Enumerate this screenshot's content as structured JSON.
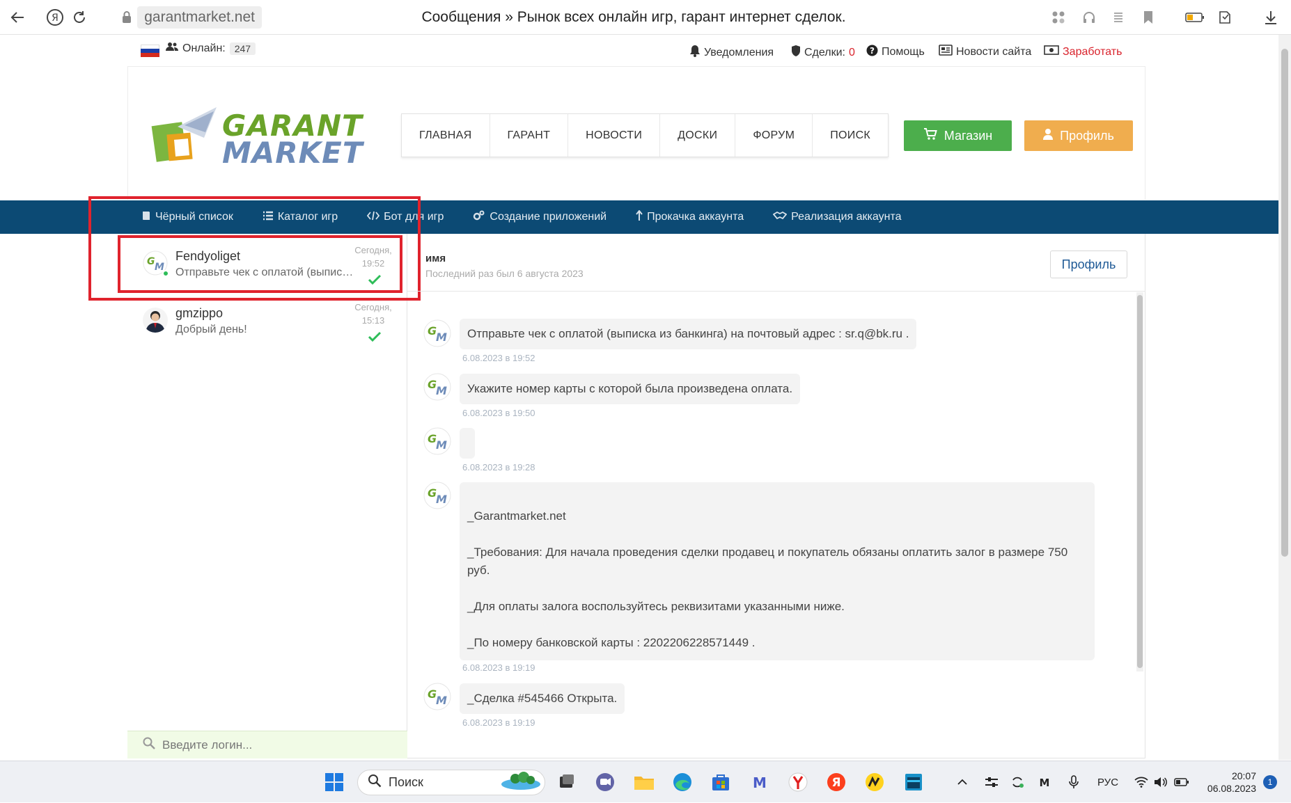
{
  "browser": {
    "domain": "garantmarket.net",
    "tab_title": "Сообщения » Рынок всех онлайн игр, гарант интернет сделок."
  },
  "topbar": {
    "online_label": "Онлайн:",
    "online_count": "247",
    "notifications": "Уведомления",
    "deals_label": "Сделки:",
    "deals_count": "0",
    "help": "Помощь",
    "site_news": "Новости сайта",
    "earn": "Заработать"
  },
  "logo": {
    "line1": "GARANT",
    "line2": "MARKET"
  },
  "mainnav": [
    "ГЛАВНАЯ",
    "ГАРАНТ",
    "НОВОСТИ",
    "ДОСКИ",
    "ФОРУМ",
    "ПОИСК"
  ],
  "buttons": {
    "shop": "Магазин",
    "profile": "Профиль"
  },
  "subnav": [
    "Чёрный список",
    "Каталог игр",
    "Бот для игр",
    "Создание приложений",
    "Прокачка аккаунта",
    "Реализация аккаунта"
  ],
  "dialogs": [
    {
      "name": "Fendyoliget",
      "preview": "Отправьте чек с оплатой (выписка из банкинга) на почтовый адрес : sr.q@bk.ru .",
      "day": "Сегодня,",
      "time": "19:52"
    },
    {
      "name": "gmzippo",
      "preview": "Добрый день!",
      "day": "Сегодня,",
      "time": "15:13"
    }
  ],
  "search_login": {
    "placeholder": "Введите логин..."
  },
  "chat": {
    "name": "имя",
    "last_seen": "Последний раз был 6 августа 2023",
    "profile_button": "Профиль",
    "messages": [
      {
        "text": "Отправьте чек с оплатой (выписка из банкинга) на почтовый адрес : sr.q@bk.ru .",
        "time": "6.08.2023 в 19:52"
      },
      {
        "text": "Укажите номер карты с которой была произведена оплата.",
        "time": "6.08.2023 в 19:50"
      },
      {
        "text": "",
        "time": "6.08.2023 в 19:28"
      },
      {
        "lines": [
          "_Garantmarket.net",
          "_Требования: Для начала проведения сделки продавец и покупатель обязаны оплатить залог в размере 750",
          "руб.",
          "_Для оплаты залога воспользуйтесь реквизитами указанными ниже.",
          "_По номеру банковской карты : 2202206228571449 ."
        ],
        "time": "6.08.2023 в 19:19"
      },
      {
        "text": "_Сделка #545466 Открыта.",
        "time": "6.08.2023 в 19:19"
      }
    ]
  },
  "taskbar": {
    "search": "Поиск",
    "lang": "РУС",
    "time": "20:07",
    "date": "06.08.2023",
    "notifications": "1"
  },
  "colors": {
    "subnav_bg": "#0c4a74",
    "shop_green": "#4cae4c",
    "profile_orange": "#f0ad4e",
    "highlight_red": "#e0232d"
  }
}
